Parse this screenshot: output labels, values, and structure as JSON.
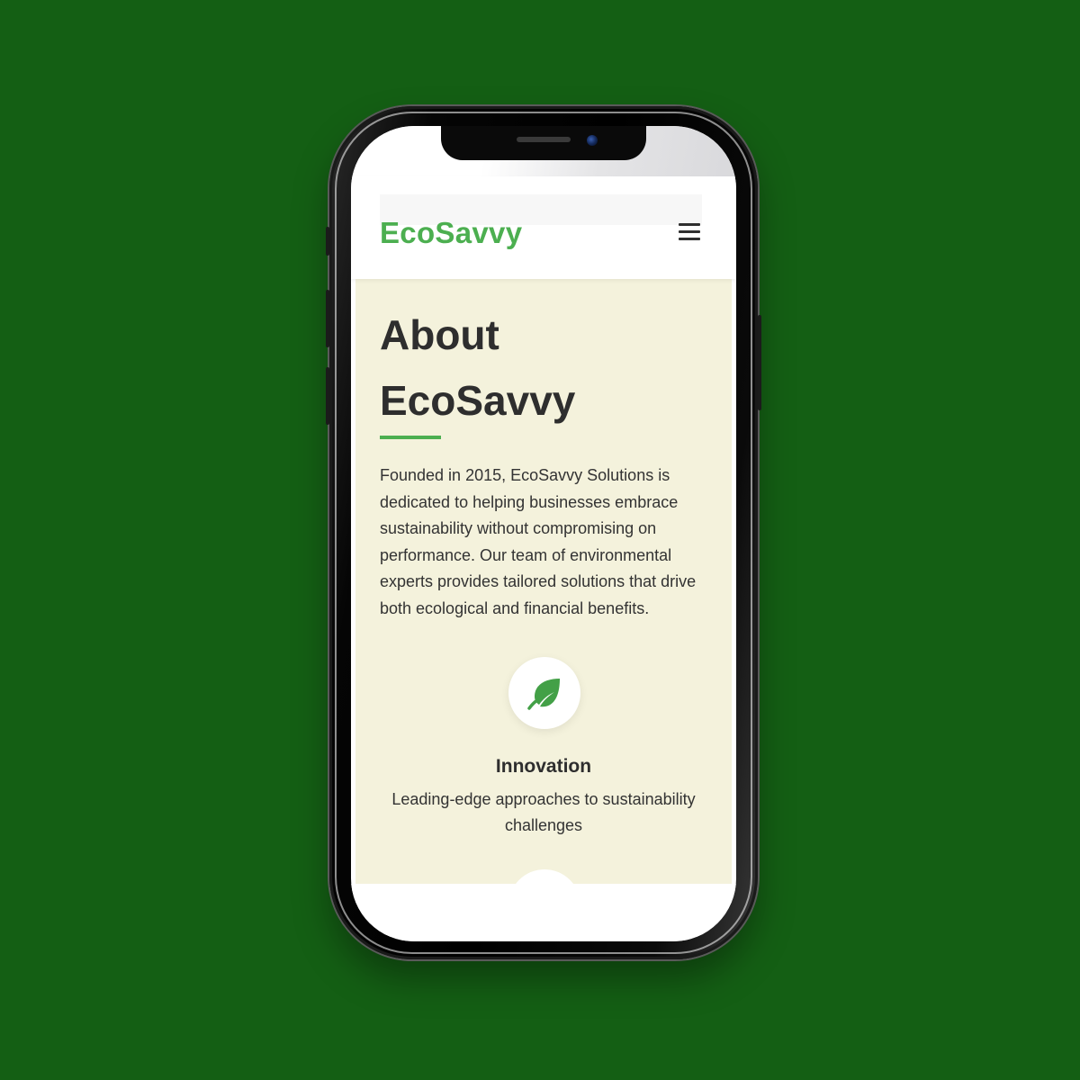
{
  "header": {
    "logo": "EcoSavvy",
    "menu_icon": "hamburger-menu-icon"
  },
  "about": {
    "title": "About EcoSavvy",
    "text": "Founded in 2015, EcoSavvy Solutions is dedicated to helping businesses embrace sustainability without compromising on performance. Our team of environmental experts provides tailored solutions that drive both ecological and financial benefits."
  },
  "features": [
    {
      "icon": "leaf-icon",
      "title": "Innovation",
      "description": "Leading-edge approaches to sustainability challenges"
    }
  ],
  "colors": {
    "background": "#145f14",
    "accent": "#4caf50",
    "section_bg": "#f4f2dc",
    "text": "#2e2e2e"
  }
}
